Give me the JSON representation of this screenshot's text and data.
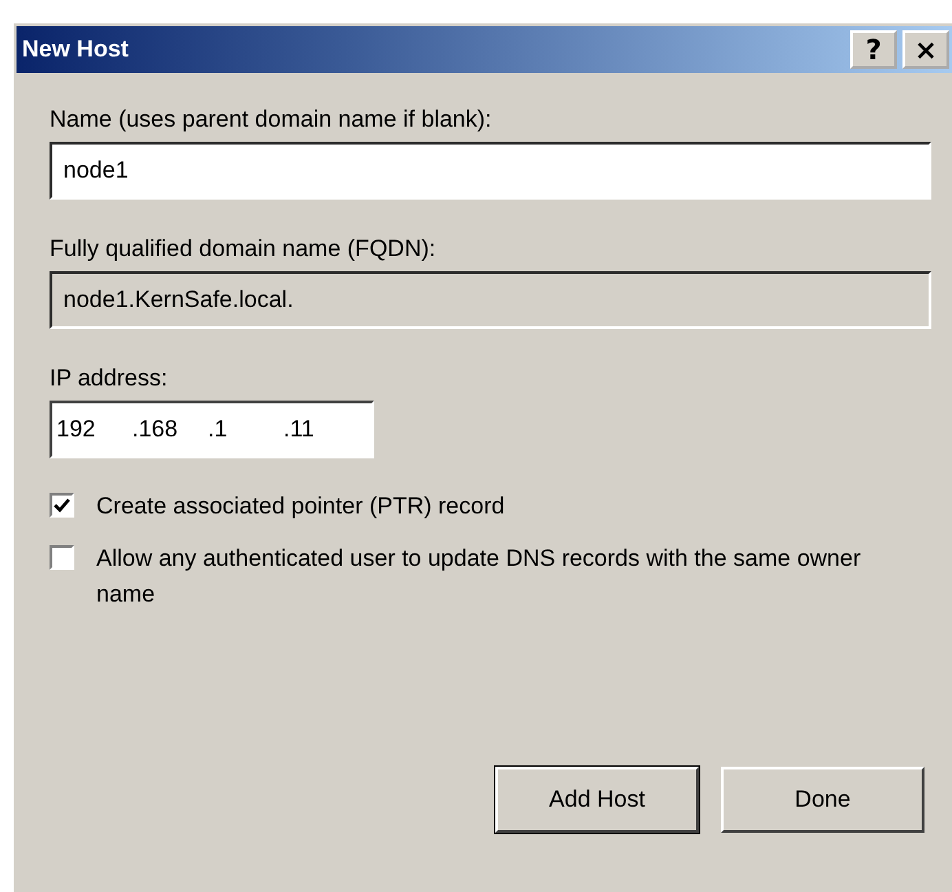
{
  "window": {
    "title": "New Host",
    "buttons": [
      {
        "label": "?"
      },
      {
        "label": "×"
      }
    ]
  },
  "name_field": {
    "label": "Name (uses parent domain name if blank):",
    "value": "node1",
    "disabled": false
  },
  "fqdn_field": {
    "label": "Fully qualified domain name (FQDN):",
    "value": "node1.KernSafe.local.",
    "disabled": true
  },
  "ip_address": {
    "label": "IP address:",
    "segments": [
      "192",
      ".168",
      ".1",
      ".11"
    ]
  },
  "checkboxes": [
    {
      "label": "Create associated pointer (PTR) record",
      "checked": true
    },
    {
      "label": "Allow any authenticated user to update DNS records with the same owner name",
      "checked": false
    }
  ],
  "buttons": [
    {
      "label": "Add Host",
      "default": true
    },
    {
      "label": "Done",
      "default": false
    }
  ]
}
